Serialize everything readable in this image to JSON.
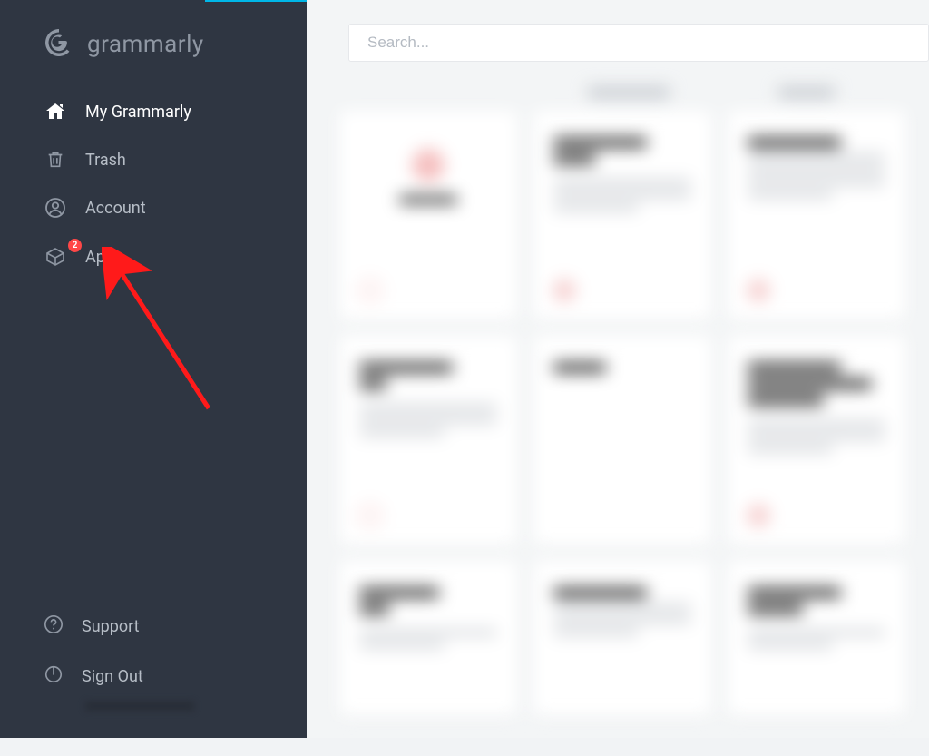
{
  "brand": {
    "name": "grammarly"
  },
  "search": {
    "placeholder": "Search..."
  },
  "sidebar": {
    "items": [
      {
        "label": "My Grammarly",
        "id": "my-grammarly",
        "active": true
      },
      {
        "label": "Trash",
        "id": "trash"
      },
      {
        "label": "Account",
        "id": "account"
      },
      {
        "label": "Apps",
        "id": "apps",
        "badge": "2"
      }
    ],
    "footer": [
      {
        "label": "Support",
        "id": "support"
      },
      {
        "label": "Sign Out",
        "id": "sign-out"
      }
    ]
  },
  "colors": {
    "sidebar_bg": "#2f3642",
    "accent": "#00b7e8",
    "badge": "#ff4747",
    "arrow": "#ff1a1a"
  },
  "annotation": {
    "type": "arrow",
    "points_to": "sidebar-item-apps"
  }
}
